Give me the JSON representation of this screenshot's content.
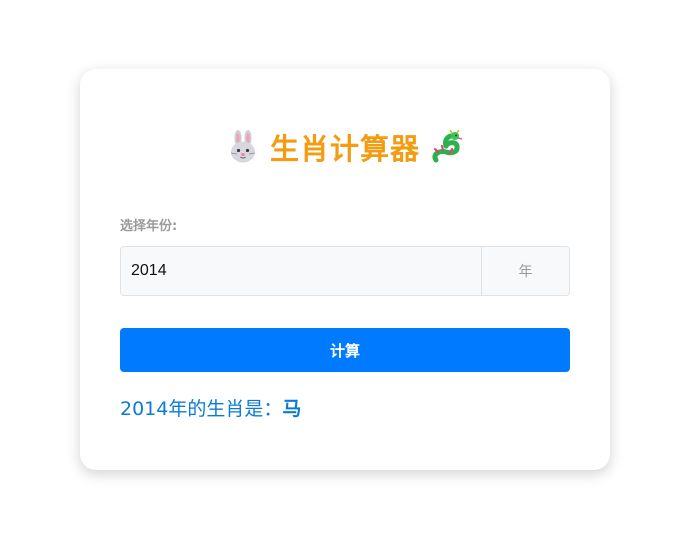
{
  "header": {
    "title": "生肖计算器",
    "left_icon": "rabbit-face-icon",
    "right_icon": "dragon-icon"
  },
  "form": {
    "label": "选择年份:",
    "year_value": "2014",
    "suffix": "年",
    "button_label": "计算"
  },
  "result": {
    "prefix": "2014年的生肖是：",
    "zodiac": "马"
  },
  "colors": {
    "title": "#f39c12",
    "button": "#007bff",
    "result": "#0a7bd6"
  }
}
